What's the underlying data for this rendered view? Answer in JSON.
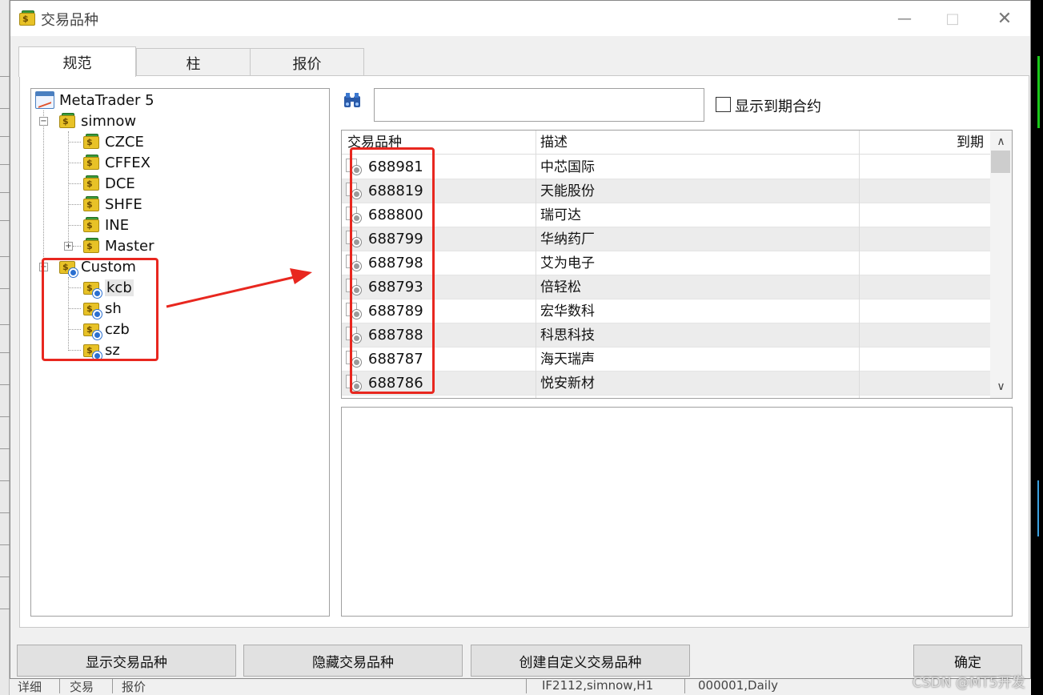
{
  "window": {
    "title": "交易品种",
    "minimize_icon": "minimize-icon",
    "maximize_icon": "maximize-icon",
    "close_icon": "close-icon"
  },
  "tabs": [
    {
      "label": "规范",
      "active": true
    },
    {
      "label": "柱",
      "active": false
    },
    {
      "label": "报价",
      "active": false
    }
  ],
  "tree": {
    "root": "MetaTrader 5",
    "server": "simnow",
    "exchanges": [
      "CZCE",
      "CFFEX",
      "DCE",
      "SHFE",
      "INE",
      "Master"
    ],
    "custom": "Custom",
    "custom_items": [
      "kcb",
      "sh",
      "czb",
      "sz"
    ],
    "selected": "kcb"
  },
  "search": {
    "value": "",
    "show_expired_label": "显示到期合约",
    "show_expired_checked": false
  },
  "table": {
    "headers": [
      "交易品种",
      "描述",
      "到期"
    ],
    "rows": [
      {
        "symbol": "688981",
        "desc": "中芯国际"
      },
      {
        "symbol": "688819",
        "desc": "天能股份"
      },
      {
        "symbol": "688800",
        "desc": "瑞可达"
      },
      {
        "symbol": "688799",
        "desc": "华纳药厂"
      },
      {
        "symbol": "688798",
        "desc": "艾为电子"
      },
      {
        "symbol": "688793",
        "desc": "倍轻松"
      },
      {
        "symbol": "688789",
        "desc": "宏华数科"
      },
      {
        "symbol": "688788",
        "desc": "科思科技"
      },
      {
        "symbol": "688787",
        "desc": "海天瑞声"
      },
      {
        "symbol": "688786",
        "desc": "悦安新材"
      }
    ]
  },
  "buttons": {
    "show": "显示交易品种",
    "hide": "隐藏交易品种",
    "create": "创建自定义交易品种",
    "ok": "确定"
  },
  "background": {
    "bottom_tabs": [
      "详细",
      "交易",
      "报价"
    ],
    "chart_tab_1": "IF2112,simnow,H1",
    "chart_tab_2": "000001,Daily"
  },
  "watermark": "CSDN @MT5开发",
  "colors": {
    "annotation_red": "#e8271f",
    "selection": "#e6e6e6",
    "row_alt": "#ececec"
  }
}
